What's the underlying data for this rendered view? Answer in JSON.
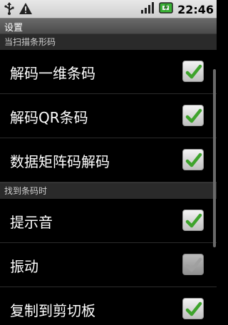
{
  "status": {
    "time": "22:46"
  },
  "title": "设置",
  "sections": [
    {
      "header": "当扫描条形码"
    },
    {
      "header": "找到条码时"
    }
  ],
  "items": [
    {
      "label": "解码一维条码",
      "checked": true,
      "enabled": true
    },
    {
      "label": "解码QR条码",
      "checked": true,
      "enabled": true
    },
    {
      "label": "数据矩阵码解码",
      "checked": true,
      "enabled": true
    },
    {
      "label": "提示音",
      "checked": true,
      "enabled": true
    },
    {
      "label": "振动",
      "checked": true,
      "enabled": false
    },
    {
      "label": "复制到剪切板",
      "checked": true,
      "enabled": true
    }
  ],
  "colors": {
    "check_green": "#3ea32c",
    "check_gray": "#bdbdbd"
  }
}
